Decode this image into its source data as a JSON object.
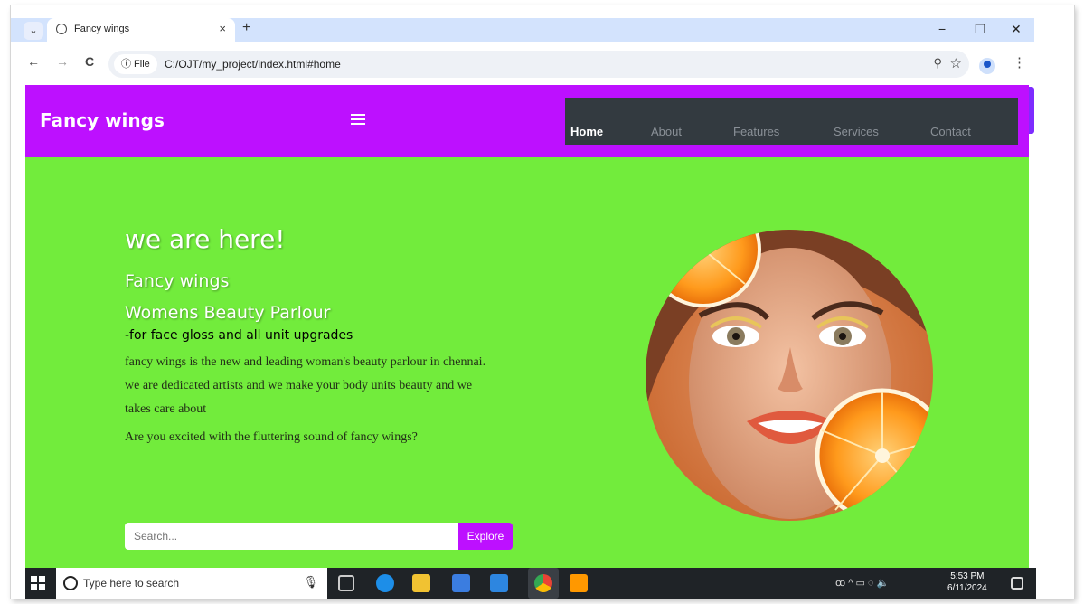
{
  "browser": {
    "tab_title": "Fancy wings",
    "tab_close": "×",
    "new_tab": "+",
    "tab_menu": "⌄",
    "address_chip": "ⓘ File",
    "url": "C:/OJT/my_project/index.html#home",
    "minimize": "−",
    "restore": "❐",
    "close": "✕",
    "back": "←",
    "forward": "→",
    "reload": "C",
    "zoom_icon": "⚲",
    "star_icon": "☆",
    "menu_icon": "⋮"
  },
  "site": {
    "brand": "Fancy wings",
    "nav": [
      {
        "label": "Home",
        "active": true
      },
      {
        "label": "About",
        "active": false
      },
      {
        "label": "Features",
        "active": false
      },
      {
        "label": "Services",
        "active": false
      },
      {
        "label": "Contact",
        "active": false
      }
    ],
    "hero": {
      "heading": "we are here!",
      "subheading_1": "Fancy wings",
      "subheading_2": "Womens Beauty Parlour",
      "tagline": "-for face gloss and all unit upgrades",
      "paragraph": "fancy wings is the new and leading woman's beauty parlour in chennai. we are dedicated artists and we make your body units beauty and we takes care about",
      "question": "Are you excited with the fluttering sound of fancy wings?"
    },
    "search": {
      "placeholder": "Search...",
      "button": "Explore"
    }
  },
  "taskbar": {
    "search_placeholder": "Type here to search",
    "mic": "🎙",
    "time": "5:53 PM",
    "date": "6/11/2024",
    "tray_symbols": "ꝏ  ^  ▭  ◌  🔈"
  },
  "colors": {
    "header": "#bd10ff",
    "page_bg": "#72ec3c",
    "nav_bg": "#333a40"
  }
}
